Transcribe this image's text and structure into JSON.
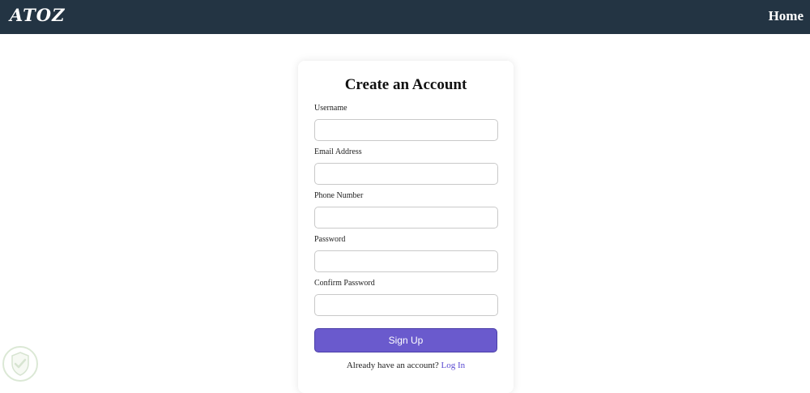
{
  "navbar": {
    "logo": "ATOZ",
    "home_link": "Home"
  },
  "form": {
    "title": "Create an Account",
    "fields": [
      {
        "label": "Username",
        "value": "",
        "placeholder": ""
      },
      {
        "label": "Email Address",
        "value": "",
        "placeholder": ""
      },
      {
        "label": "Phone Number",
        "value": "",
        "placeholder": ""
      },
      {
        "label": "Password",
        "value": "",
        "placeholder": ""
      },
      {
        "label": "Confirm Password",
        "value": "",
        "placeholder": ""
      }
    ],
    "submit_label": "Sign Up",
    "login_prompt": "Already have an account?",
    "login_link": "Log In"
  },
  "colors": {
    "navbar_bg": "#233443",
    "accent": "#6a5acd",
    "link": "#5a4ad1"
  },
  "icons": {
    "watermark": "shield-check-icon"
  }
}
